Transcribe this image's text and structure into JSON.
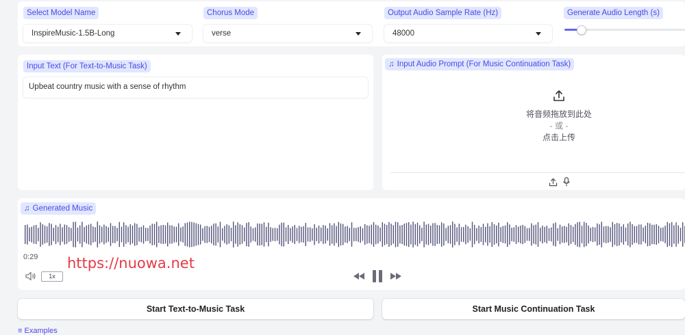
{
  "controls": {
    "model": {
      "label": "Select Model Name",
      "value": "InspireMusic-1.5B-Long"
    },
    "chorus": {
      "label": "Chorus Mode",
      "value": "verse"
    },
    "sample_rate": {
      "label": "Output Audio Sample Rate (Hz)",
      "value": "48000"
    },
    "length": {
      "label": "Generate Audio Length (s)",
      "slider_fraction": 0.12
    }
  },
  "input_text": {
    "label": "Input Text (For Text-to-Music Task)",
    "value": "Upbeat country music with a sense of rhythm"
  },
  "audio_prompt": {
    "label": "Input Audio Prompt (For Music Continuation Task)",
    "drop_text": "将音频拖放到此处",
    "or_text": "- 或 -",
    "click_text": "点击上传"
  },
  "generated": {
    "label": "Generated Music",
    "time": "0:29",
    "speed": "1x"
  },
  "buttons": {
    "text_to_music": "Start Text-to-Music Task",
    "continuation": "Start Music Continuation Task"
  },
  "examples_label": "Examples",
  "watermark": "https://nuowa.net",
  "colors": {
    "accent": "#6366f1",
    "label_bg": "#e0e7ff",
    "label_text": "#4f46e5",
    "waveform": "#52527a"
  }
}
